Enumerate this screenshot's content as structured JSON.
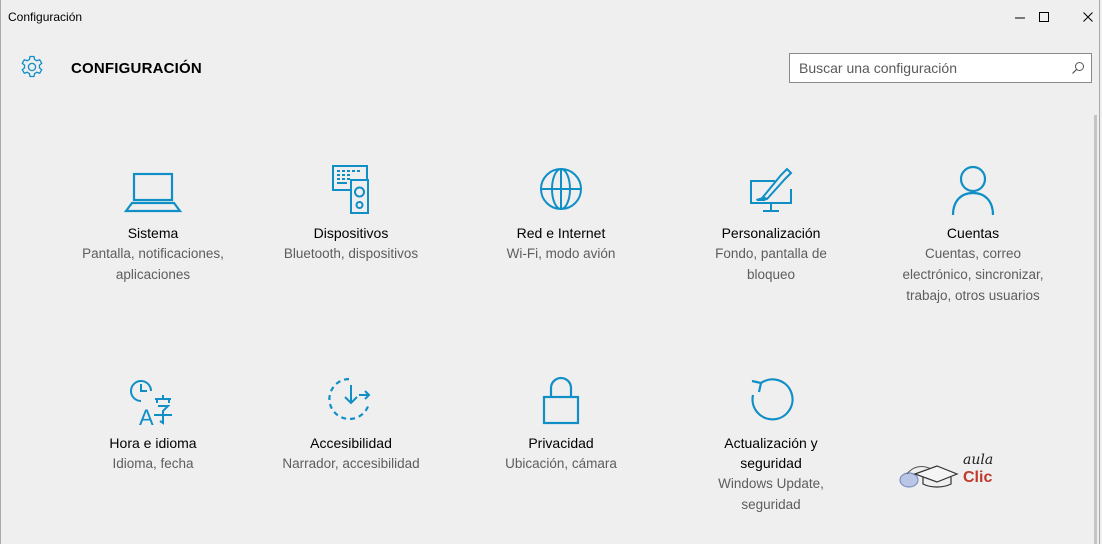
{
  "window": {
    "title": "Configuración",
    "minimize_icon": "minimize-icon",
    "maximize_icon": "maximize-icon",
    "close_icon": "close-icon"
  },
  "header": {
    "title": "CONFIGURACIÓN",
    "icon": "gear-icon"
  },
  "search": {
    "placeholder": "Buscar una configuración",
    "icon": "search-icon"
  },
  "accent_color": "#0f8fc6",
  "tiles": [
    {
      "name": "Sistema",
      "desc": [
        "Pantalla, notificaciones,",
        "aplicaciones"
      ],
      "icon": "laptop-icon"
    },
    {
      "name": "Dispositivos",
      "desc": [
        "Bluetooth, dispositivos"
      ],
      "icon": "devices-icon"
    },
    {
      "name": "Red e Internet",
      "desc": [
        "Wi-Fi, modo avión"
      ],
      "icon": "globe-icon"
    },
    {
      "name": "Personalización",
      "desc": [
        "Fondo, pantalla de",
        "bloqueo"
      ],
      "icon": "personalization-icon"
    },
    {
      "name": "Cuentas",
      "desc": [
        "Cuentas, correo",
        "electrónico, sincronizar,",
        "trabajo, otros usuarios"
      ],
      "icon": "person-icon"
    },
    {
      "name": "Hora e idioma",
      "desc": [
        "Idioma, fecha"
      ],
      "icon": "time-language-icon"
    },
    {
      "name": "Accesibilidad",
      "desc": [
        "Narrador, accesibilidad"
      ],
      "icon": "accessibility-icon"
    },
    {
      "name": "Privacidad",
      "desc": [
        "Ubicación, cámara"
      ],
      "icon": "lock-icon"
    },
    {
      "name": [
        "Actualización y",
        "seguridad"
      ],
      "desc": [
        "Windows Update,",
        "seguridad"
      ],
      "icon": "update-icon"
    }
  ],
  "watermark": {
    "line1": "aula",
    "line2": "Clic"
  }
}
